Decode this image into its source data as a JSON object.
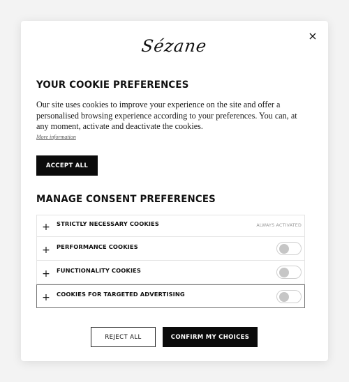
{
  "modal": {
    "close_icon": "×",
    "logo_text": "Sézane",
    "title": "YOUR COOKIE PREFERENCES",
    "description": "Our site uses cookies to improve your experience on the site and offer a personalised browsing experience according to your preferences. You can, at any moment, activate and deactivate the cookies.",
    "more_info": "More information",
    "accept_all": "ACCEPT ALL",
    "manage_title": "MANAGE CONSENT PREFERENCES",
    "expand_icon": "+",
    "consents": [
      {
        "label": "STRICTLY NECESSARY COOKIES",
        "status": "ALWAYS ACTIVATED"
      },
      {
        "label": "PERFORMANCE COOKIES",
        "enabled": false
      },
      {
        "label": "FUNCTIONALITY COOKIES",
        "enabled": false
      },
      {
        "label": "COOKIES FOR TARGETED ADVERTISING",
        "enabled": false
      }
    ],
    "reject_all": "REJECT ALL",
    "confirm": "CONFIRM MY CHOICES"
  },
  "colors": {
    "primary": "#0b0b0b",
    "background": "#ffffff",
    "muted_text": "#9a9a9a"
  }
}
